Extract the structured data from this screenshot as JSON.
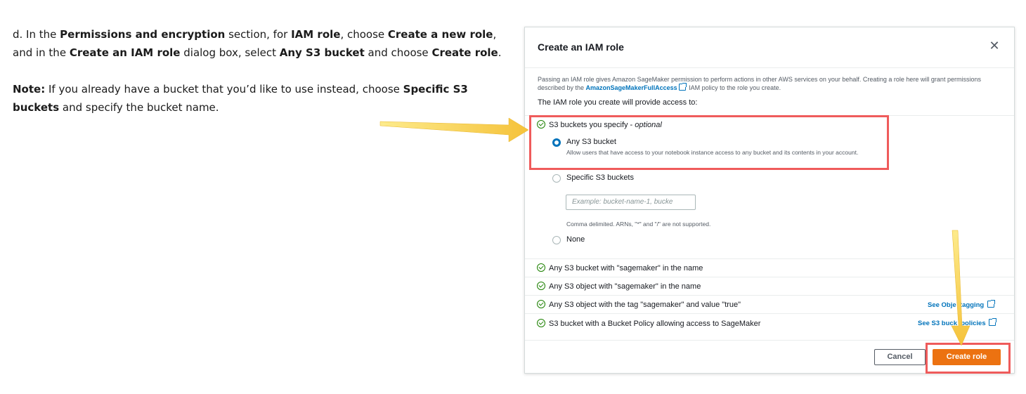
{
  "instructions": {
    "step_prefix": "d. In the ",
    "permissions_section": "Permissions and encryption",
    "section_mid": " section, for ",
    "iam_role": "IAM role",
    "choose_1": ", choose ",
    "create_new_role": "Create a new role",
    "comma": ",",
    "and_in_the": "and in the ",
    "create_iam_role_dialog": "Create an IAM role",
    "dialog_mid": " dialog box, select ",
    "any_s3_bucket": "Any S3 bucket",
    "and_choose": " and choose ",
    "create_role": "Create role",
    "period": ".",
    "note_label": "Note:",
    "note_text_1": " If you already have a bucket that you’d like to use instead, choose ",
    "specific_s3": "Specific S3",
    "buckets": "buckets",
    "note_text_2": " and specify the bucket name."
  },
  "dialog": {
    "title": "Create an IAM role",
    "close_glyph": "✕",
    "description_1": "Passing an IAM role gives Amazon SageMaker permission to perform actions in other AWS services on your behalf. Creating a role here will grant permissions described by the ",
    "policy_link": "AmazonSageMakerFullAccess",
    "description_2": " IAM policy to the role you create.",
    "access_heading": "The IAM role you create will provide access to:",
    "s3_buckets_specify": "S3 buckets you specify - ",
    "optional": "optional",
    "radio_any": "Any S3 bucket",
    "radio_any_help": "Allow users that have access to your notebook instance access to any bucket and its contents in your account.",
    "radio_specific": "Specific S3 buckets",
    "bucket_placeholder": "Example: bucket-name-1, bucke",
    "bucket_hint": "Comma delimited. ARNs, \"*\" and \"/\" are not supported.",
    "radio_none": "None",
    "access_items": [
      "Any S3 bucket with \"sagemaker\" in the name",
      "Any S3 object with \"sagemaker\" in the name",
      "Any S3 object with the tag \"sagemaker\" and value \"true\"",
      "S3 bucket with a Bucket Policy allowing access to SageMaker"
    ],
    "link_object_tagging": "See Obje  tagging",
    "link_bucket_policies": "See S3 buck  policies",
    "cancel_label": "Cancel",
    "create_role_label": "Create role"
  },
  "colors": {
    "accent_blue": "#0073bb",
    "primary_orange": "#ec7211",
    "success_green": "#1d8102",
    "highlight_red": "#ef5b5b",
    "arrow_yellow": "#f7c842"
  }
}
